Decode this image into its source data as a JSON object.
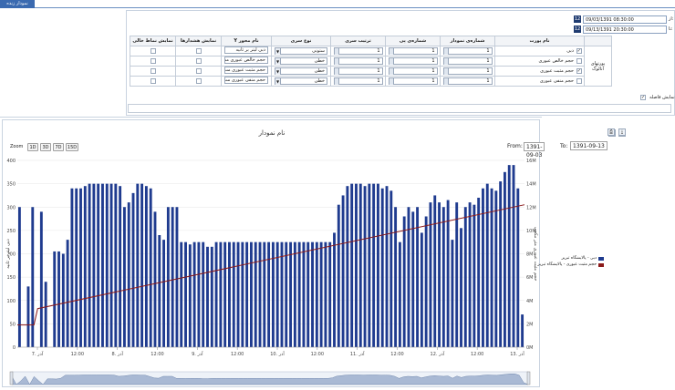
{
  "window": {
    "tab_label": "نمودار زنده"
  },
  "dates": {
    "from_label": "از:",
    "to_label": "تا:",
    "from_value": "09/03/1391 08:30:00",
    "to_value": "09/13/1391 20:30:00",
    "calendar_icon": "12"
  },
  "table": {
    "headers": [
      "نام پورت",
      "شماره‌ی نمودار",
      "شماره‌ی پی",
      "ترتیب سری",
      "نوع سری",
      "نام محور Y",
      "نمایش هشدارها",
      "نمایش نماط خالی"
    ],
    "group_label": "پورتهای آنالوگ",
    "rows": [
      {
        "name": "دبی",
        "chart_no": "1",
        "p_no": "1",
        "order": "1",
        "type": "ستونی",
        "axis": "دبی لیتر بر ثانیه",
        "checked": true
      },
      {
        "name": "حجم خالص عبوری",
        "chart_no": "1",
        "p_no": "1",
        "order": "1",
        "type": "خطی",
        "axis": "حجم خالص عبوری مت",
        "checked": false
      },
      {
        "name": "حجم مثبت عبوری",
        "chart_no": "1",
        "p_no": "1",
        "order": "1",
        "type": "خطی",
        "axis": "حجم مثبت عبوری مت",
        "checked": true
      },
      {
        "name": "حجم منفی عبوری",
        "chart_no": "1",
        "p_no": "1",
        "order": "1",
        "type": "خطی",
        "axis": "حجم منفی عبوری مت",
        "checked": false
      }
    ],
    "interval_label": "نمایش فاصله"
  },
  "chart": {
    "title": "نام نمودار",
    "zoom_label": "Zoom",
    "zoom_buttons": [
      "1D",
      "3D",
      "7D",
      "15D"
    ],
    "from_label": "From:",
    "from_value": "1391-09-03",
    "to_label": "To:",
    "to_value": "1391-09-13",
    "left_axis_title": "دبی لیتر بر ثانیه",
    "right_axis_title": "حجم مثبت عبوری متر مکعب",
    "legend": [
      {
        "label": "دبی - پالایشگاه تبریز",
        "color": "#1f3b8f"
      },
      {
        "label": "حجم مثبت عبوری - پالایشگاه تبریز",
        "color": "#8b1a1a"
      }
    ],
    "bar_color": "#1f3b8f",
    "line_color": "#8b1a1a"
  },
  "chart_data": {
    "type": "bar",
    "left_ticks": [
      "0",
      "50",
      "100",
      "150",
      "200",
      "250",
      "300",
      "350",
      "400"
    ],
    "right_ticks": [
      "0M",
      "2M",
      "4M",
      "6M",
      "8M",
      "10M",
      "12M",
      "14M",
      "16M"
    ],
    "x_ticks": [
      "7. آذر",
      "12:00",
      "8. آذر",
      "12:00",
      "9. آذر",
      "12:00",
      "10. آذر",
      "12:00",
      "11. آذر",
      "12:00",
      "12. آذر",
      "12:00",
      "13. آذر"
    ],
    "bars": [
      300,
      0,
      130,
      300,
      0,
      290,
      140,
      0,
      205,
      205,
      200,
      230,
      340,
      340,
      340,
      345,
      350,
      350,
      350,
      350,
      350,
      350,
      350,
      345,
      300,
      310,
      330,
      350,
      350,
      345,
      340,
      290,
      240,
      230,
      300,
      300,
      300,
      225,
      225,
      220,
      225,
      225,
      225,
      215,
      215,
      225,
      225,
      225,
      225,
      225,
      225,
      225,
      225,
      225,
      225,
      225,
      225,
      225,
      225,
      225,
      225,
      225,
      225,
      225,
      225,
      225,
      225,
      225,
      225,
      225,
      225,
      225,
      245,
      305,
      325,
      345,
      350,
      350,
      350,
      345,
      350,
      350,
      350,
      340,
      345,
      335,
      300,
      225,
      280,
      300,
      290,
      300,
      245,
      280,
      310,
      325,
      310,
      300,
      315,
      230,
      310,
      255,
      300,
      310,
      305,
      320,
      340,
      350,
      340,
      335,
      355,
      375,
      390,
      390,
      340,
      70
    ],
    "line": {
      "start": 1.9,
      "step_at": 0.04,
      "jump_to": 3.3,
      "end": 12.2
    }
  }
}
